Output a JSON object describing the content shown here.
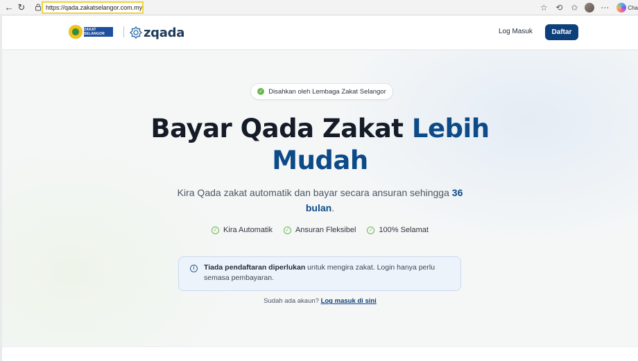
{
  "browser": {
    "url": "https://qada.zakatselangor.com.my",
    "profile_label": "Cha"
  },
  "header": {
    "partner_logo_text": "ZAKAT SELANGOR",
    "brand_name": "zqada",
    "login_label": "Log Masuk",
    "register_label": "Daftar"
  },
  "hero": {
    "badge_text": "Disahkan oleh Lembaga Zakat Selangor",
    "headline_main": "Bayar Qada Zakat ",
    "headline_accent_1": "Lebih",
    "headline_accent_2": "Mudah",
    "subtext_main": "Kira Qada zakat automatik dan bayar secara ansuran sehingga ",
    "subtext_accent": "36 bulan",
    "subtext_end": ".",
    "features": [
      {
        "label": "Kira Automatik"
      },
      {
        "label": "Ansuran Fleksibel"
      },
      {
        "label": "100% Selamat"
      }
    ],
    "info_bold": "Tiada pendaftaran diperlukan",
    "info_rest": " untuk mengira zakat. Login hanya perlu semasa pembayaran.",
    "login_prompt": "Sudah ada akaun? ",
    "login_prompt_link": "Log masuk di sini"
  },
  "colors": {
    "brand_navy": "#0d3f7a",
    "accent_blue": "#0d4a88",
    "check_green": "#67b84a",
    "url_highlight": "#f2d33b"
  }
}
